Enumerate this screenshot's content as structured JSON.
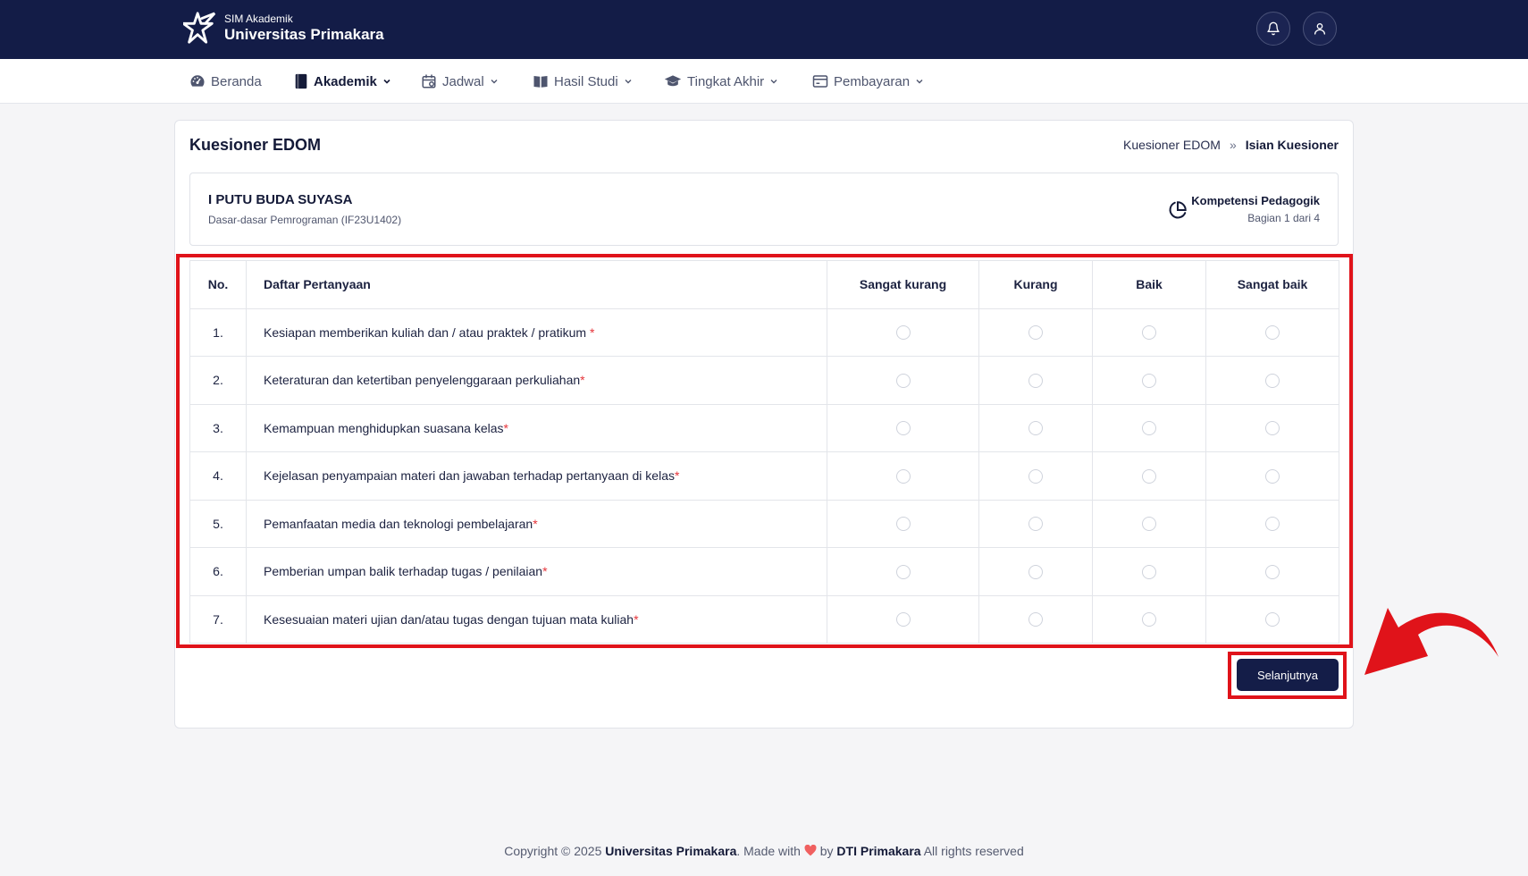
{
  "app": {
    "subtitle": "SIM Akademik",
    "name": "Universitas Primakara"
  },
  "nav": [
    {
      "label": "Beranda",
      "icon": "dashboard-icon",
      "active": false
    },
    {
      "label": "Akademik",
      "icon": "book-icon",
      "active": true
    },
    {
      "label": "Jadwal",
      "icon": "calendar-icon",
      "active": false
    },
    {
      "label": "Hasil Studi",
      "icon": "open-book-icon",
      "active": false
    },
    {
      "label": "Tingkat Akhir",
      "icon": "graduation-cap-icon",
      "active": false
    },
    {
      "label": "Pembayaran",
      "icon": "credit-card-icon",
      "active": false
    }
  ],
  "page": {
    "title": "Kuesioner EDOM",
    "breadcrumb": {
      "parent": "Kuesioner EDOM",
      "separator": "»",
      "current": "Isian Kuesioner"
    }
  },
  "info": {
    "lecturer": "I PUTU BUDA SUYASA",
    "course": "Dasar-dasar Pemrograman (IF23U1402)",
    "section_name": "Kompetensi Pedagogik",
    "section_part": "Bagian 1 dari 4"
  },
  "table": {
    "headers": {
      "num": "No.",
      "question": "Daftar Pertanyaan",
      "options": [
        "Sangat kurang",
        "Kurang",
        "Baik",
        "Sangat baik"
      ]
    },
    "rows": [
      {
        "num": "1.",
        "question": "Kesiapan memberikan kuliah dan / atau praktek / pratikum ",
        "required": "*"
      },
      {
        "num": "2.",
        "question": "Keteraturan dan ketertiban penyelenggaraan perkuliahan",
        "required": "*"
      },
      {
        "num": "3.",
        "question": "Kemampuan menghidupkan suasana kelas",
        "required": "*"
      },
      {
        "num": "4.",
        "question": "Kejelasan penyampaian materi dan jawaban terhadap pertanyaan di kelas",
        "required": "*"
      },
      {
        "num": "5.",
        "question": "Pemanfaatan media dan teknologi pembelajaran",
        "required": "*"
      },
      {
        "num": "6.",
        "question": "Pemberian umpan balik terhadap tugas / penilaian",
        "required": "*"
      },
      {
        "num": "7.",
        "question": "Kesesuaian materi ujian dan/atau tugas dengan tujuan mata kuliah",
        "required": "*"
      }
    ]
  },
  "next_button": "Selanjutnya",
  "footer": {
    "prefix": "Copyright © 2025 ",
    "org": "Universitas Primakara",
    "middle": ". Made with ",
    "by": " by ",
    "team": "DTI Primakara",
    "suffix": " All rights reserved"
  },
  "colors": {
    "primary": "#131c47",
    "highlight": "#e0131a",
    "required": "#e5343a",
    "heart": "#f06060"
  }
}
